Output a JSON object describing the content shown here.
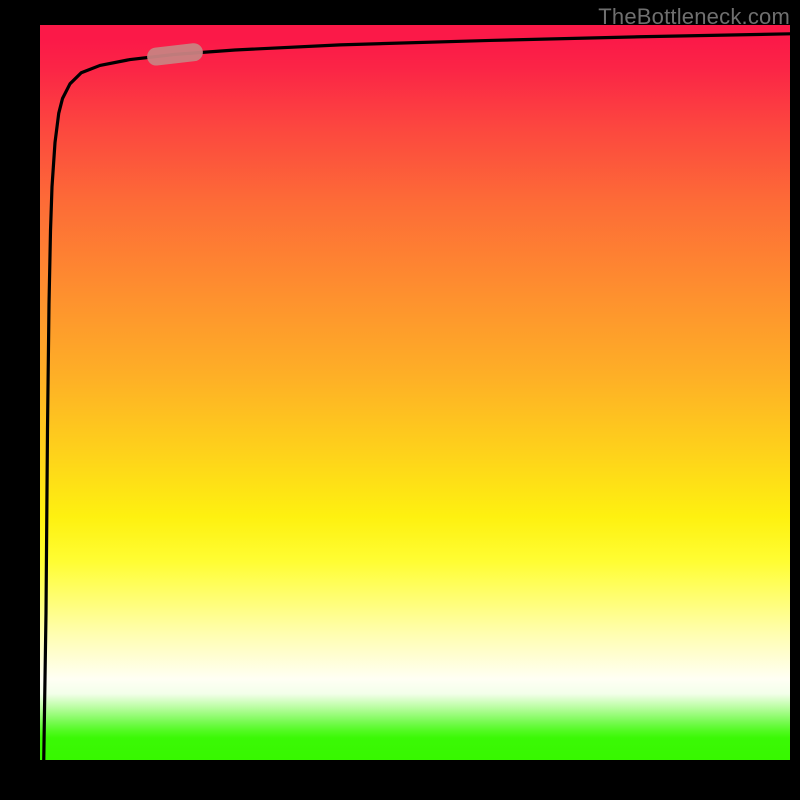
{
  "watermark": "TheBottleneck.com",
  "chart_data": {
    "type": "line",
    "title": "",
    "xlabel": "",
    "ylabel": "",
    "xlim": [
      0,
      100
    ],
    "ylim": [
      0,
      100
    ],
    "x": [
      0.5,
      0.8,
      1.0,
      1.2,
      1.4,
      1.6,
      2.0,
      2.5,
      3.0,
      4.0,
      5.5,
      8.0,
      12.0,
      18.0,
      26.0,
      40.0,
      60.0,
      80.0,
      100.0
    ],
    "values": [
      0.0,
      20.0,
      45.0,
      62.0,
      72.0,
      78.0,
      84.0,
      88.0,
      90.0,
      92.0,
      93.5,
      94.5,
      95.3,
      96.0,
      96.6,
      97.3,
      97.9,
      98.4,
      98.8
    ],
    "marker": {
      "x": 18.0,
      "y": 96.0,
      "color": "#c98282",
      "shape": "capsule"
    },
    "gradient": {
      "top_color": "#fb1948",
      "mid_color": "#fef110",
      "bottom_color": "#37f800"
    }
  }
}
